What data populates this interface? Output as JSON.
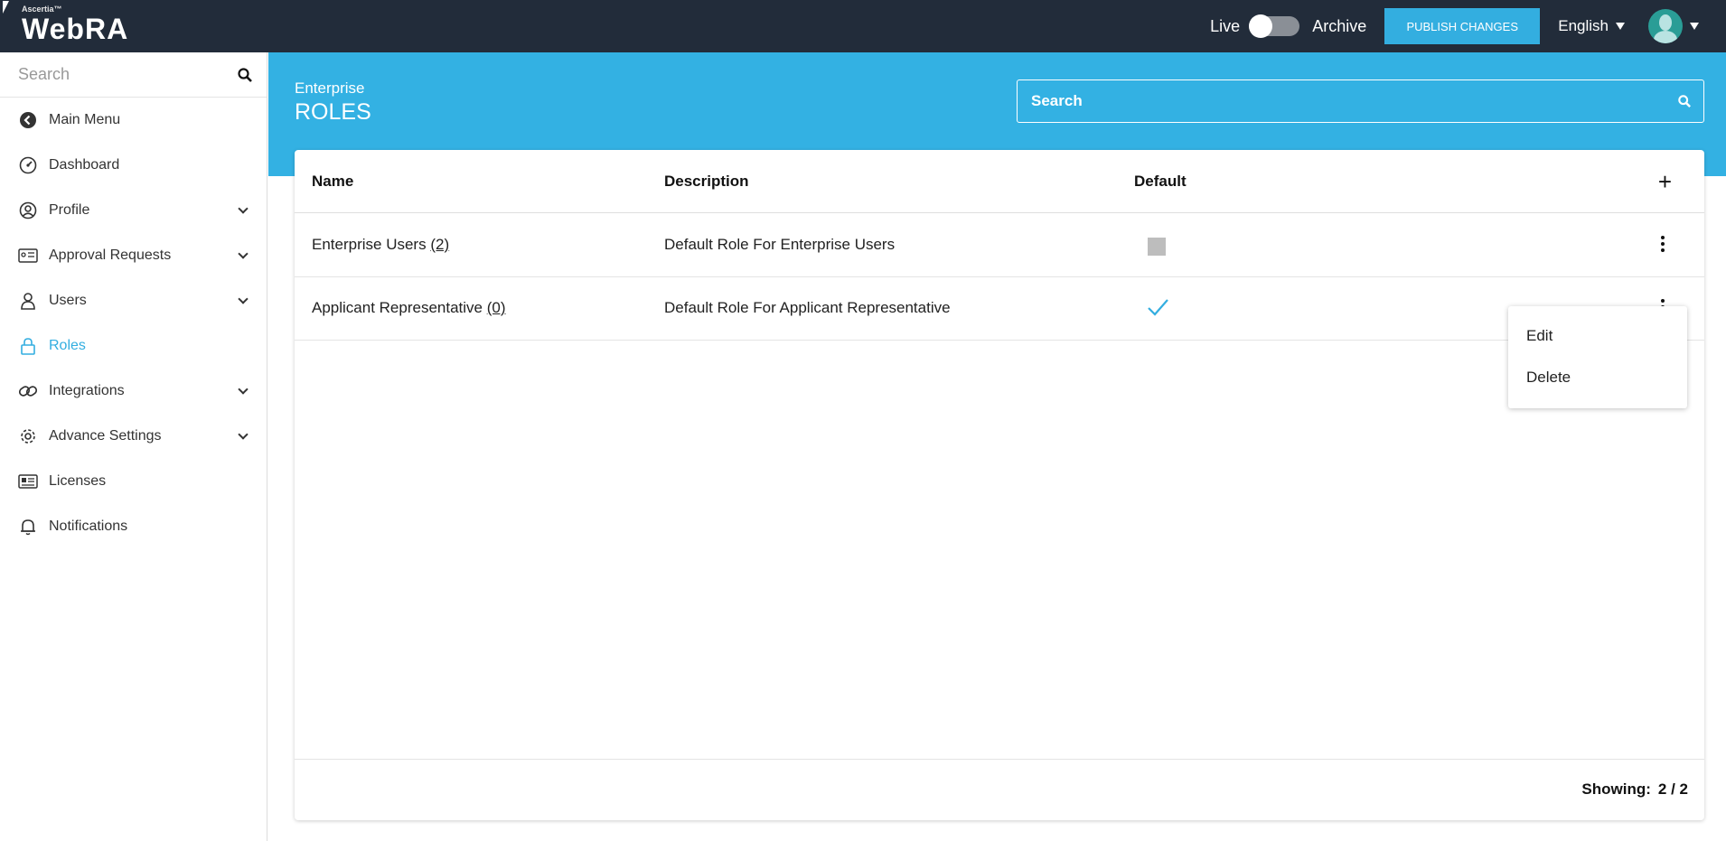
{
  "topbar": {
    "logo_small": "Ascertia™",
    "logo_big": "WebRA",
    "live_label": "Live",
    "archive_label": "Archive",
    "publish_label": "PUBLISH CHANGES",
    "language": "English"
  },
  "sidebar": {
    "search_placeholder": "Search",
    "items": [
      {
        "label": "Main Menu",
        "icon": "back-circle-icon"
      },
      {
        "label": "Dashboard",
        "icon": "gauge-icon"
      },
      {
        "label": "Profile",
        "icon": "user-circle-icon"
      },
      {
        "label": "Approval Requests",
        "icon": "approval-card-icon"
      },
      {
        "label": "Users",
        "icon": "users-icon"
      },
      {
        "label": "Roles",
        "icon": "lock-icon"
      },
      {
        "label": "Integrations",
        "icon": "link-icon"
      },
      {
        "label": "Advance Settings",
        "icon": "gear-icon"
      },
      {
        "label": "Licenses",
        "icon": "id-card-icon"
      },
      {
        "label": "Notifications",
        "icon": "bell-icon"
      }
    ]
  },
  "main": {
    "breadcrumb": "Enterprise",
    "title": "ROLES",
    "search_placeholder": "Search",
    "table": {
      "headers": {
        "name": "Name",
        "description": "Description",
        "default": "Default"
      },
      "rows": [
        {
          "name": "Enterprise Users",
          "count": "(2)",
          "description": "Default Role For Enterprise Users",
          "default": false
        },
        {
          "name": "Applicant Representative",
          "count": "(0)",
          "description": "Default Role For Applicant Representative",
          "default": true
        }
      ]
    },
    "showing_label": "Showing:",
    "showing_value": "2 / 2"
  },
  "context_menu": {
    "edit": "Edit",
    "delete": "Delete"
  },
  "colors": {
    "topbar_bg": "#222c3a",
    "accent": "#33aee0"
  }
}
